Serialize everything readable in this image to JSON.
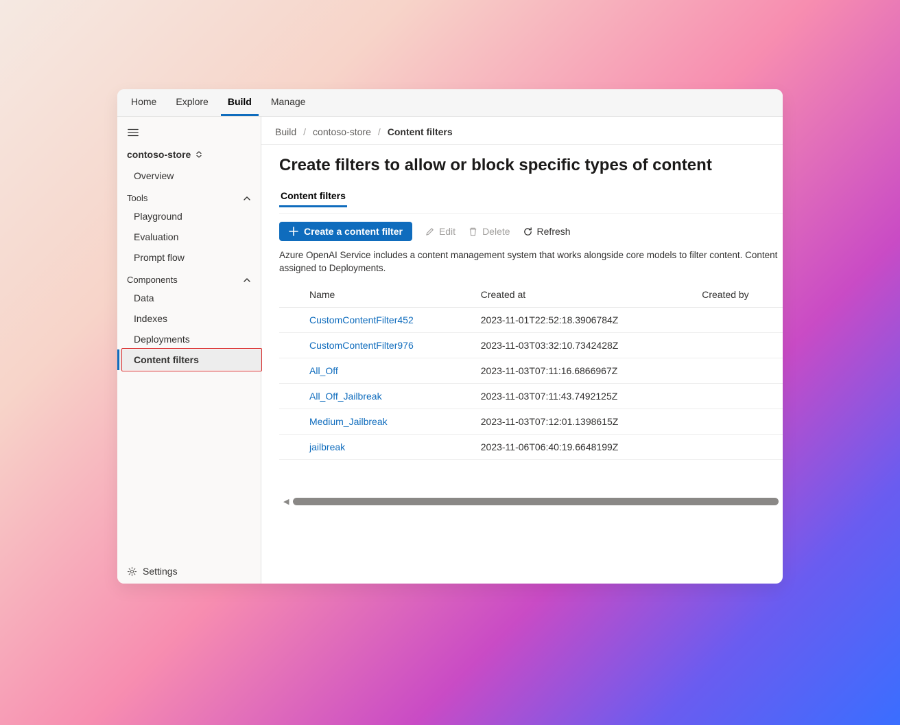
{
  "topnav": {
    "tabs": [
      "Home",
      "Explore",
      "Build",
      "Manage"
    ],
    "active": "Build"
  },
  "sidebar": {
    "store": "contoso-store",
    "overview": "Overview",
    "tools_label": "Tools",
    "tools": [
      "Playground",
      "Evaluation",
      "Prompt flow"
    ],
    "components_label": "Components",
    "components": [
      "Data",
      "Indexes",
      "Deployments",
      "Content filters"
    ],
    "active": "Content filters",
    "settings": "Settings"
  },
  "breadcrumb": {
    "items": [
      "Build",
      "contoso-store",
      "Content filters"
    ]
  },
  "page": {
    "title": "Create filters to allow or block specific types of content",
    "subtab": "Content filters",
    "create_label": "Create a content filter",
    "edit_label": "Edit",
    "delete_label": "Delete",
    "refresh_label": "Refresh",
    "description": "Azure OpenAI Service includes a content management system that works alongside core models to filter content. Content assigned to Deployments."
  },
  "table": {
    "columns": [
      "Name",
      "Created at",
      "Created by"
    ],
    "rows": [
      {
        "name": "CustomContentFilter452",
        "created_at": "2023-11-01T22:52:18.3906784Z"
      },
      {
        "name": "CustomContentFilter976",
        "created_at": "2023-11-03T03:32:10.7342428Z"
      },
      {
        "name": "All_Off",
        "created_at": "2023-11-03T07:11:16.6866967Z"
      },
      {
        "name": "All_Off_Jailbreak",
        "created_at": "2023-11-03T07:11:43.7492125Z"
      },
      {
        "name": "Medium_Jailbreak",
        "created_at": "2023-11-03T07:12:01.1398615Z"
      },
      {
        "name": "jailbreak",
        "created_at": "2023-11-06T06:40:19.6648199Z"
      }
    ]
  }
}
